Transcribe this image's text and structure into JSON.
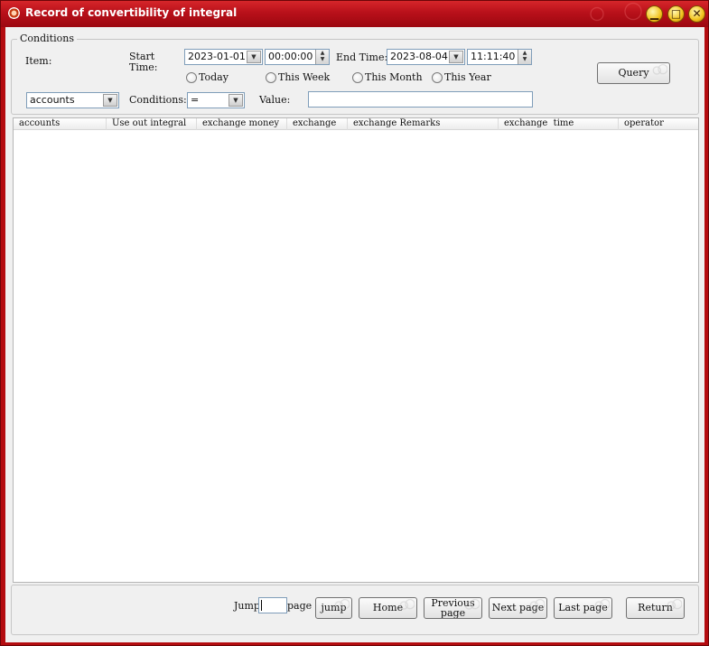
{
  "window": {
    "title": "Record of convertibility of integral"
  },
  "conditions": {
    "legend": "Conditions",
    "item_label": "Item:",
    "start_label_1": "Start",
    "start_label_2": "Time:",
    "start_date": "2023-01-01",
    "start_time": "00:00:00",
    "end_label": "End Time:",
    "end_date": "2023-08-04",
    "end_time": "11:11:40",
    "radios": [
      "Today",
      "This Week",
      "This Month",
      "This Year"
    ],
    "item_select": "accounts",
    "conditions_label": "Conditions:",
    "condition_select": "=",
    "value_label": "Value:",
    "value_input": "",
    "query_label": "Query"
  },
  "table": {
    "columns": [
      "accounts",
      "Use out integral",
      "exchange money",
      "exchange",
      "exchange Remarks",
      "exchange  time",
      "operator"
    ],
    "rows": []
  },
  "footer": {
    "jump_label": "Jump",
    "page_label": "page",
    "jump_input": "",
    "jump_button": "jump",
    "home_button": "Home",
    "previous_button_1": "Previous",
    "previous_button_2": "page",
    "next_button": "Next page",
    "last_button": "Last page",
    "return_button": "Return"
  }
}
